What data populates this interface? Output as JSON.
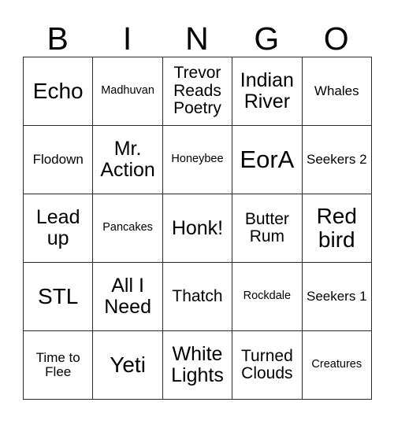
{
  "card": {
    "title": "BINGO",
    "header_letters": [
      "B",
      "I",
      "N",
      "G",
      "O"
    ],
    "colors": {
      "background": "#ffffff",
      "border": "#2b2b2b",
      "text": "#000000"
    },
    "grid": {
      "rows": 5,
      "columns": 5,
      "cells": [
        [
          {
            "text": "Echo",
            "size": "lg"
          },
          {
            "text": "Madhuvan",
            "size": "xxs"
          },
          {
            "text": "Trevor Reads Poetry",
            "size": "sm"
          },
          {
            "text": "Indian River",
            "size": "md"
          },
          {
            "text": "Whales",
            "size": "xs"
          }
        ],
        [
          {
            "text": "Flodown",
            "size": "xs"
          },
          {
            "text": "Mr. Action",
            "size": "md"
          },
          {
            "text": "Honeybee",
            "size": "xxs"
          },
          {
            "text": "EorA",
            "size": "xl"
          },
          {
            "text": "Seekers 2",
            "size": "xs"
          }
        ],
        [
          {
            "text": "Lead up",
            "size": "md"
          },
          {
            "text": "Pancakes",
            "size": "xxs"
          },
          {
            "text": "Honk!",
            "size": "md"
          },
          {
            "text": "Butter Rum",
            "size": "sm"
          },
          {
            "text": "Red bird",
            "size": "lg"
          }
        ],
        [
          {
            "text": "STL",
            "size": "lg"
          },
          {
            "text": "All I Need",
            "size": "md"
          },
          {
            "text": "Thatch",
            "size": "sm"
          },
          {
            "text": "Rockdale",
            "size": "xxs"
          },
          {
            "text": "Seekers 1",
            "size": "xs"
          }
        ],
        [
          {
            "text": "Time to Flee",
            "size": "xs"
          },
          {
            "text": "Yeti",
            "size": "lg"
          },
          {
            "text": "White Lights",
            "size": "md"
          },
          {
            "text": "Turned Clouds",
            "size": "sm"
          },
          {
            "text": "Creatures",
            "size": "xxs"
          }
        ]
      ]
    }
  }
}
